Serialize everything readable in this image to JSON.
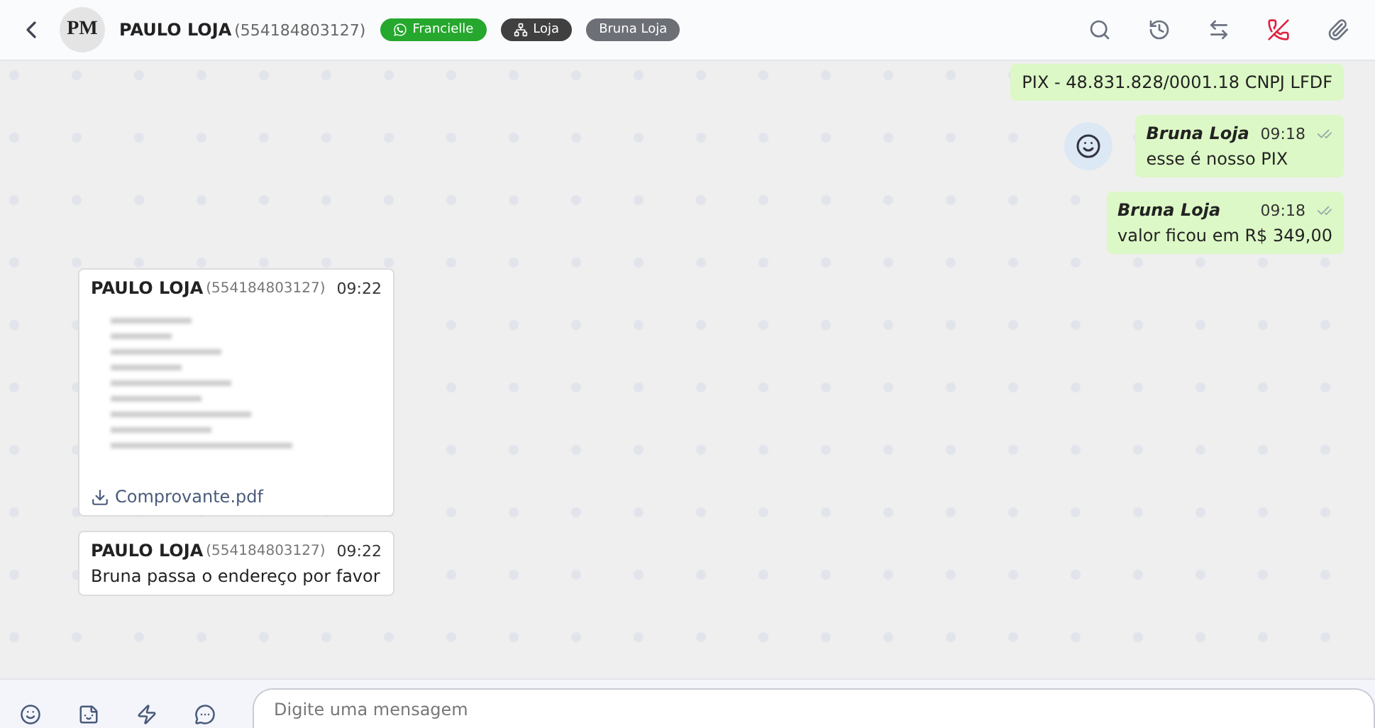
{
  "header": {
    "contact_name": "PAULO LOJA",
    "contact_phone": "(554184803127)",
    "avatar_text": "PM",
    "tags": [
      {
        "kind": "whatsapp",
        "label": "Francielle",
        "color": "#25a82d"
      },
      {
        "kind": "department",
        "label": "Loja",
        "color": "#404040"
      },
      {
        "kind": "user",
        "label": "Bruna Loja",
        "color": "#6c6f75"
      }
    ]
  },
  "messages": [
    {
      "kind": "text",
      "outgoing": true,
      "text": "PIX - 48.831.828/0001.18 CNPJ LFDF"
    },
    {
      "kind": "text",
      "outgoing": true,
      "sender": "Bruna Loja",
      "time": "09:18",
      "text": "esse é nosso PIX",
      "reaction_button": true
    },
    {
      "kind": "text",
      "outgoing": true,
      "sender": "Bruna Loja",
      "time": "09:18",
      "text": "valor ficou em R$ 349,00"
    },
    {
      "kind": "file",
      "outgoing": false,
      "sender": "PAULO LOJA",
      "phone": "(554184803127)",
      "time": "09:22",
      "file_name": "Comprovante.pdf"
    },
    {
      "kind": "text",
      "outgoing": false,
      "sender": "PAULO LOJA",
      "phone": "(554184803127)",
      "time": "09:22",
      "text": "Bruna passa o endereço por favor"
    }
  ],
  "composer": {
    "placeholder": "Digite uma mensagem"
  }
}
